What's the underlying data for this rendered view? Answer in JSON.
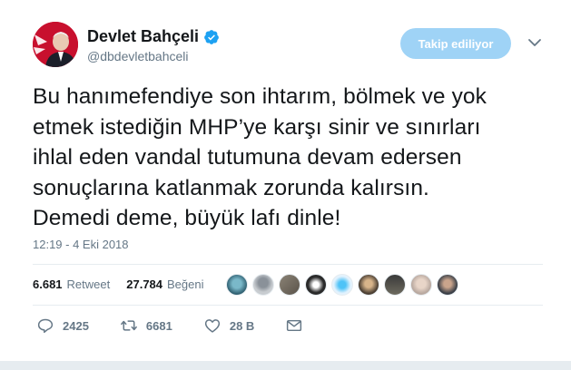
{
  "user": {
    "name": "Devlet Bahçeli",
    "handle": "@dbdevletbahceli",
    "verified": true
  },
  "follow_button": {
    "label": "Takip ediliyor"
  },
  "tweet": {
    "lines": [
      "Bu hanımefendiye son ihtarım, bölmek ve yok",
      "etmek istediğin MHP’ye karşı sinir ve sınırları",
      "ihlal eden vandal tutumuna devam edersen",
      "sonuçlarına katlanmak zorunda kalırsın.",
      "Demedi deme, büyük lafı dinle!"
    ],
    "timestamp": "12:19 - 4 Eki 2018"
  },
  "stats": {
    "retweet_count": "6.681",
    "retweet_label": "Retweet",
    "like_count": "27.784",
    "like_label": "Beğeni"
  },
  "actions": {
    "reply_count": "2425",
    "retweet_count": "6681",
    "like_count": "28 B"
  },
  "colors": {
    "accent": "#1da1f2",
    "follow_button_bg": "#9fd3f6",
    "secondary_text": "#657786",
    "divider": "#e6ecf0"
  }
}
